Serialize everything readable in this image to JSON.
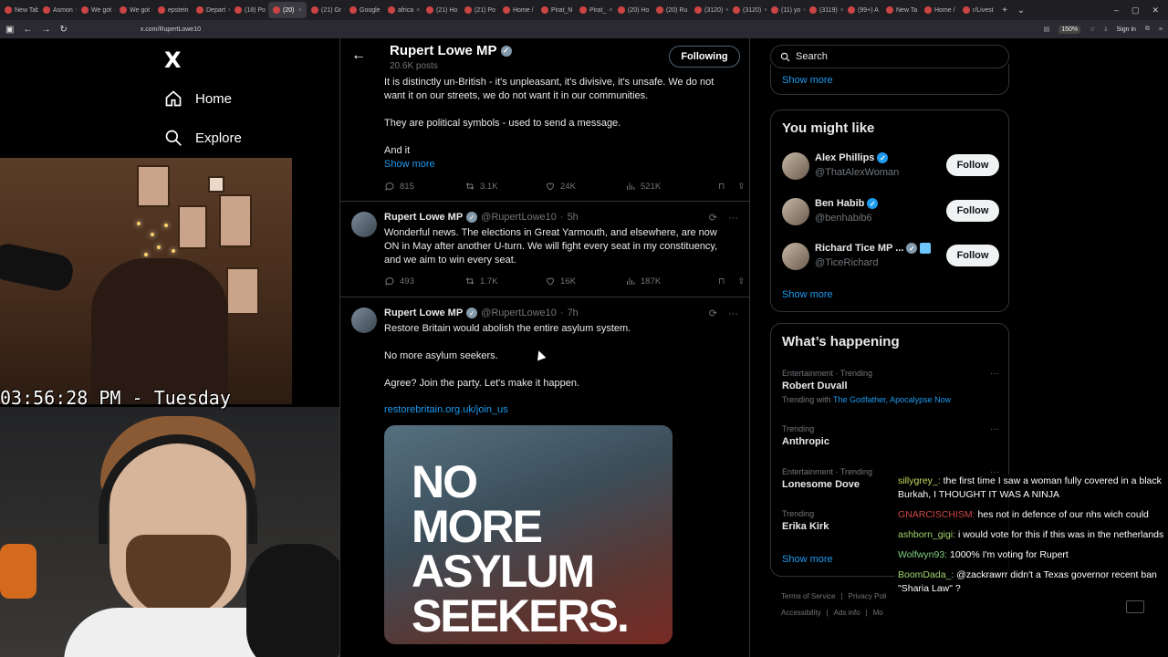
{
  "browser": {
    "tabs": [
      "New Tab",
      "Asmon",
      "We got",
      "We got",
      "epstein",
      "Depart",
      "(18) Po",
      "(20)",
      "(21) Gr",
      "Google",
      "africa",
      "(21) Ho",
      "(21) Po",
      "Home /",
      "Pirat_N",
      "Pirat_",
      "(20) Ho",
      "(20) Ru",
      "(3120)",
      "(3120)",
      "(11) yo",
      "(3119)",
      "(99+) A",
      "New Ta",
      "Home /",
      "r/Livest"
    ],
    "active_tab_index": 7,
    "url": "x.com/RupertLowe10",
    "zoom": "150%",
    "signin_label": "Sign in"
  },
  "leftnav": {
    "logo": "X",
    "items": [
      {
        "label": "Home",
        "icon": "home-icon"
      },
      {
        "label": "Explore",
        "icon": "search-icon"
      }
    ]
  },
  "overlay": {
    "clock": "03:56:28 PM - Tuesday"
  },
  "profile": {
    "name": "Rupert Lowe MP",
    "posts": "20.6K posts",
    "follow_state": "Following"
  },
  "tweets": [
    {
      "text": "It is distinctly un-British - it's unpleasant, it's divisive, it's unsafe. We do not\nwant it on our streets, we do not want it in our communities.\n\nThey are political symbols - used to send a message.\n\nAnd it",
      "show_more": "Show more",
      "replies": "815",
      "reposts": "3.1K",
      "likes": "24K",
      "views": "521K"
    },
    {
      "name": "Rupert Lowe MP",
      "handle": "@RupertLowe10",
      "time": "5h",
      "text": "Wonderful news. The elections in Great Yarmouth, and elsewhere, are now\nON in May after another U-turn. We will fight every seat in my constituency,\nand we aim to win every seat.",
      "replies": "493",
      "reposts": "1.7K",
      "likes": "16K",
      "views": "187K"
    },
    {
      "name": "Rupert Lowe MP",
      "handle": "@RupertLowe10",
      "time": "7h",
      "text": "Restore Britain would abolish the entire asylum system.\n\nNo more asylum seekers.\n\nAgree? Join the party. Let's make it happen.",
      "link": "restorebritain.org.uk/join_us",
      "media_text": "NO\nMORE\nASYLUM\nSEEKERS."
    }
  ],
  "sidebar": {
    "search_placeholder": "Search",
    "show_more_top": "Show more",
    "you_might_like": {
      "title": "You might like",
      "users": [
        {
          "name": "Alex Phillips",
          "handle": "@ThatAlexWoman",
          "button": "Follow"
        },
        {
          "name": "Ben Habib",
          "handle": "@benhabib6",
          "button": "Follow"
        },
        {
          "name": "Richard Tice MP ...",
          "handle": "@TiceRichard",
          "button": "Follow"
        }
      ],
      "show_more": "Show more"
    },
    "whats_happening": {
      "title": "What’s happening",
      "trends": [
        {
          "context": "Entertainment · Trending",
          "name": "Robert Duvall",
          "with_label": "Trending with",
          "with_links": "The Godfather, Apocalypse Now"
        },
        {
          "context": "Trending",
          "name": "Anthropic"
        },
        {
          "context": "Entertainment · Trending",
          "name": "Lonesome Dove"
        },
        {
          "context": "Trending",
          "name": "Erika Kirk"
        }
      ],
      "show_more": "Show more"
    },
    "footer": [
      "Terms of Service",
      "|",
      "Privacy Poli",
      "Accessibility",
      "|",
      "Ads info",
      "|",
      "Mo"
    ]
  },
  "chat": [
    {
      "user": "sillygrey_:",
      "text": "the first time I saw a woman fully covered in a black Burkah, I THOUGHT IT WAS A NINJA"
    },
    {
      "user": "GNARCISCHISM:",
      "text": "hes not in defence of our nhs wich could"
    },
    {
      "user": "ashborn_gigi:",
      "text": "i would vote for this if this was in the netherlands"
    },
    {
      "user": "Wolfwyn93:",
      "text": "1000% I'm voting for Rupert"
    },
    {
      "user": "BoomDada_:",
      "text": "@zackrawrr didn't a Texas governor recent ban \"Sharia Law\" ?"
    }
  ],
  "colors": {
    "accent": "#1d9bf0",
    "bg": "#000000",
    "border": "#2f3336",
    "muted": "#71767b"
  }
}
